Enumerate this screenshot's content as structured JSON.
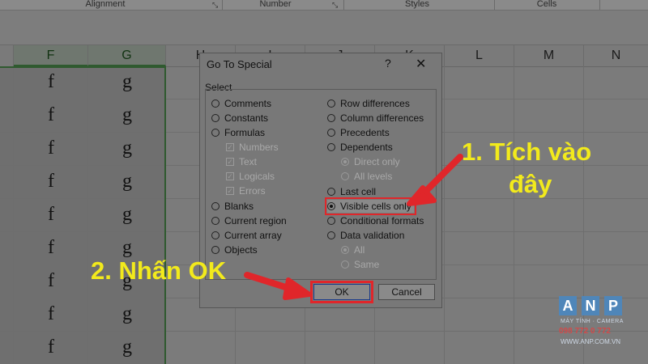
{
  "ribbon": {
    "groups": [
      "Alignment",
      "Number",
      "Styles",
      "Cells"
    ],
    "launcher": "⤡"
  },
  "sheet": {
    "col_letters": [
      "F",
      "G",
      "H",
      "I",
      "J",
      "K",
      "L",
      "M",
      "N"
    ],
    "cells_f": [
      "f",
      "f",
      "f",
      "f",
      "f",
      "f",
      "f",
      "f",
      "f"
    ],
    "cells_g": [
      "g",
      "g",
      "g",
      "g",
      "g",
      "g",
      "g",
      "g",
      "g"
    ]
  },
  "dialog": {
    "title": "Go To Special",
    "help": "?",
    "close": "✕",
    "group_label": "Select",
    "left_options": [
      {
        "label": "Comments",
        "state": "off"
      },
      {
        "label": "Constants",
        "state": "off"
      },
      {
        "label": "Formulas",
        "state": "off"
      },
      {
        "label": "Numbers",
        "state": "checked-disabled"
      },
      {
        "label": "Text",
        "state": "checked-disabled"
      },
      {
        "label": "Logicals",
        "state": "checked-disabled"
      },
      {
        "label": "Errors",
        "state": "checked-disabled"
      },
      {
        "label": "Blanks",
        "state": "off"
      },
      {
        "label": "Current region",
        "state": "off"
      },
      {
        "label": "Current array",
        "state": "off"
      },
      {
        "label": "Objects",
        "state": "off"
      }
    ],
    "right_options": [
      {
        "label": "Row differences",
        "state": "off"
      },
      {
        "label": "Column differences",
        "state": "off"
      },
      {
        "label": "Precedents",
        "state": "off"
      },
      {
        "label": "Dependents",
        "state": "off"
      },
      {
        "label": "Direct only",
        "state": "disabled-on"
      },
      {
        "label": "All levels",
        "state": "disabled"
      },
      {
        "label": "Last cell",
        "state": "off"
      },
      {
        "label": "Visible cells only",
        "state": "on"
      },
      {
        "label": "Conditional formats",
        "state": "off"
      },
      {
        "label": "Data validation",
        "state": "off"
      },
      {
        "label": "All",
        "state": "disabled-on"
      },
      {
        "label": "Same",
        "state": "disabled"
      }
    ],
    "ok_label": "OK",
    "cancel_label": "Cancel"
  },
  "annotations": {
    "step1_line1": "1. Tích vào",
    "step1_line2": "đây",
    "step2": "2. Nhấn OK",
    "accent_color": "#e0262a",
    "text_color": "#f2ea1c"
  },
  "logo": {
    "letters": [
      "A",
      "N",
      "P"
    ],
    "subtitle": "MÁY TÍNH · CAMERA",
    "phone": "098 772 0 772",
    "website": "WWW.ANP.COM.VN"
  }
}
